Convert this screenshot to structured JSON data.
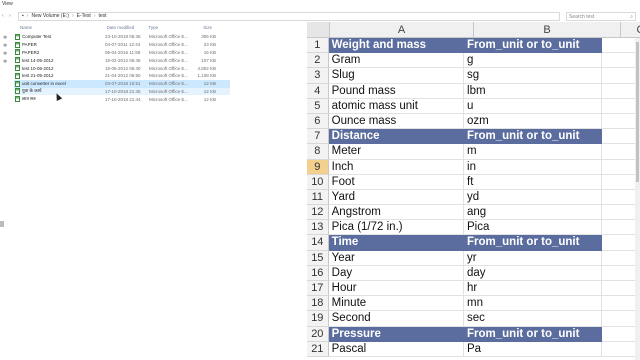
{
  "menu": {
    "view_label": "View"
  },
  "breadcrumb": {
    "items": [
      "New Volume (E:)",
      "E-Test",
      "test"
    ]
  },
  "search": {
    "placeholder": "Search test"
  },
  "file_columns": {
    "name": "Name",
    "date": "Date modified",
    "type": "Type",
    "size": "Size"
  },
  "files": [
    {
      "name": "Computer Test",
      "date": "23-10-2018 06:35",
      "type": "Microsoft Office E...",
      "size": "306 KB",
      "icon": "excel-file-icon",
      "state": ""
    },
    {
      "name": "PAPER",
      "date": "04-07-2011 12:44",
      "type": "Microsoft Office E...",
      "size": "23 KB",
      "icon": "excel-file-icon",
      "state": ""
    },
    {
      "name": "PAPER2",
      "date": "06-04-2016 11:58",
      "type": "Microsoft Office E...",
      "size": "16 KB",
      "icon": "excel-file-icon",
      "state": ""
    },
    {
      "name": "test 14-05-2012",
      "date": "18-02-2012 06:46",
      "type": "Microsoft Office E...",
      "size": "107 KB",
      "icon": "excel-file-icon",
      "state": ""
    },
    {
      "name": "test 10-06-2012",
      "date": "18-05-2012 06:40",
      "type": "Microsoft Office E...",
      "size": "4,852 KB",
      "icon": "excel-file-icon",
      "state": ""
    },
    {
      "name": "test 21-05-2012",
      "date": "21-04-2012 06:50",
      "type": "Microsoft Office E...",
      "size": "1,108 KB",
      "icon": "excel-file-icon",
      "state": ""
    },
    {
      "name": "unit converter in excel",
      "date": "03-07-2018 10:51",
      "type": "Microsoft Office E...",
      "size": "12 KB",
      "icon": "excel-file-icon",
      "state": "sel"
    },
    {
      "name": "युवा के कार्य",
      "date": "17-10-2018 21:45",
      "type": "Microsoft Office E...",
      "size": "12 KB",
      "icon": "excel-file-icon",
      "state": "hover"
    },
    {
      "name": "छात्र सत्र",
      "date": "17-10-2018 21:44",
      "type": "Microsoft Office E...",
      "size": "12 KB",
      "icon": "excel-file-icon",
      "state": ""
    }
  ],
  "sheet": {
    "columns": [
      "A",
      "B",
      "C"
    ],
    "active_row": "9",
    "rows": [
      {
        "num": "1",
        "a": "Weight and mass",
        "b": "From_unit or to_unit",
        "head": true
      },
      {
        "num": "2",
        "a": "Gram",
        "b": "g"
      },
      {
        "num": "3",
        "a": "Slug",
        "b": "sg"
      },
      {
        "num": "4",
        "a": "Pound mass",
        "b": "lbm"
      },
      {
        "num": "5",
        "a": "atomic mass unit",
        "b": "u"
      },
      {
        "num": "6",
        "a": "Ounce mass",
        "b": "ozm"
      },
      {
        "num": "7",
        "a": "Distance",
        "b": "From_unit or to_unit",
        "head": true
      },
      {
        "num": "8",
        "a": "Meter",
        "b": "m"
      },
      {
        "num": "9",
        "a": "Inch",
        "b": "in"
      },
      {
        "num": "10",
        "a": "Foot",
        "b": "ft"
      },
      {
        "num": "11",
        "a": "Yard",
        "b": "yd"
      },
      {
        "num": "12",
        "a": "Angstrom",
        "b": "ang"
      },
      {
        "num": "13",
        "a": "Pica (1/72 in.)",
        "b": "Pica"
      },
      {
        "num": "14",
        "a": "Time",
        "b": "From_unit or to_unit",
        "head": true
      },
      {
        "num": "15",
        "a": "Year",
        "b": "yr"
      },
      {
        "num": "16",
        "a": "Day",
        "b": "day"
      },
      {
        "num": "17",
        "a": "Hour",
        "b": "hr"
      },
      {
        "num": "18",
        "a": "Minute",
        "b": "mn"
      },
      {
        "num": "19",
        "a": "Second",
        "b": "sec"
      },
      {
        "num": "20",
        "a": "Pressure",
        "b": "From_unit or to_unit",
        "head": true
      },
      {
        "num": "21",
        "a": "Pascal",
        "b": "Pa"
      }
    ]
  },
  "colors": {
    "header_fill": "#5b6d9e",
    "active_row": "#f3d08d",
    "selected_file": "#cce8ff"
  }
}
